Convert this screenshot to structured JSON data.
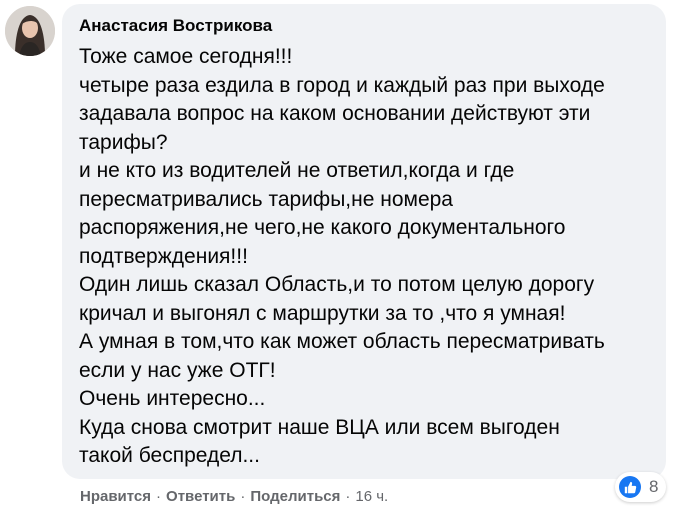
{
  "comment": {
    "author": "Анастасия Вострикова",
    "lines": [
      "Тоже самое сегодня!!!",
      "четыре раза ездила в город и каждый раз при выходе",
      "задавала вопрос на каком основании действуют эти",
      "тарифы?",
      "и не кто из водителей не ответил,когда и где",
      "пересматривались тарифы,не номера",
      "распоряжения,не чего,не какого документального",
      "подтверждения!!!",
      "Один лишь сказал Область,и то потом целую дорогу",
      "кричал и выгонял с маршрутки за то ,что я умная!",
      "А умная в том,что как может область пересматривать",
      "если у нас уже ОТГ!",
      "Очень интересно...",
      "Куда снова смотрит наше ВЦА или всем выгоден",
      "такой беспредел..."
    ]
  },
  "actions": {
    "like": "Нравится",
    "reply": "Ответить",
    "share": "Поделиться",
    "separator": "·",
    "time": "16 ч."
  },
  "reactions": {
    "icon": "like-icon",
    "count": "8",
    "color": "#1877f2"
  }
}
